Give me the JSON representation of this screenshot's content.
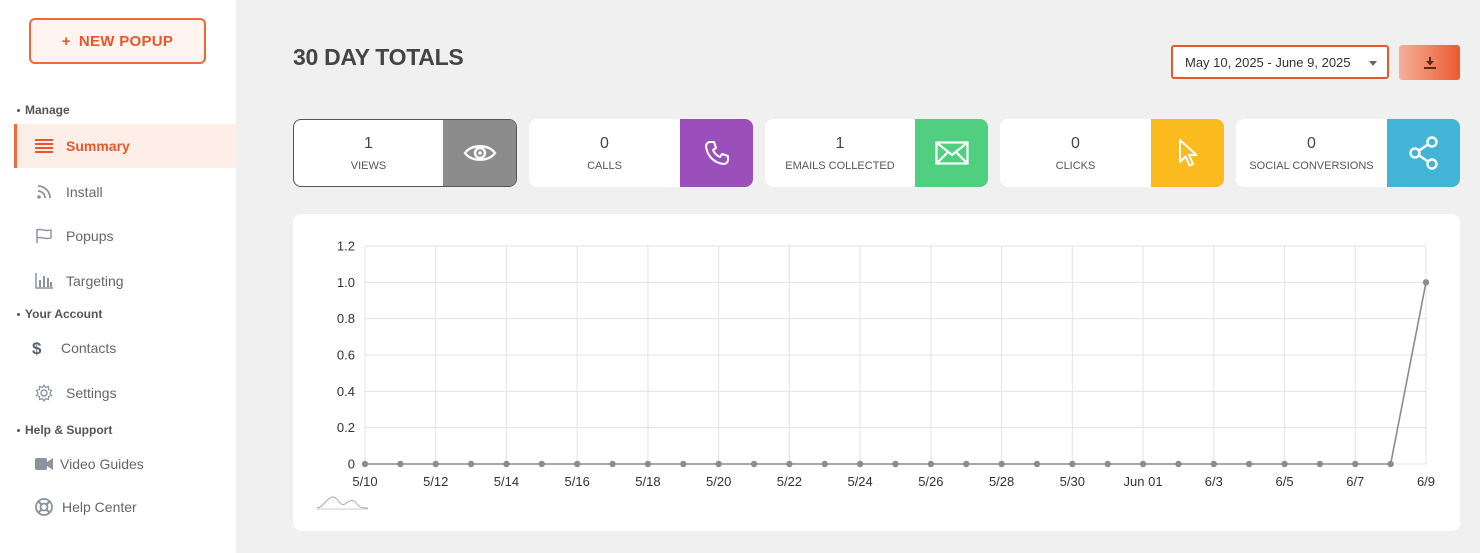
{
  "sidebar": {
    "new_popup_label": "NEW POPUP",
    "new_popup_icon": "+",
    "sections": {
      "manage": "Manage",
      "your_account": "Your Account",
      "help_support": "Help & Support"
    },
    "items": {
      "summary": "Summary",
      "install": "Install",
      "popups": "Popups",
      "targeting": "Targeting",
      "contacts": "Contacts",
      "settings": "Settings",
      "video_guides": "Video Guides",
      "help_center": "Help Center"
    }
  },
  "header": {
    "title": "30 DAY TOTALS",
    "date_range": "May 10, 2025 - June 9, 2025",
    "download_icon": "download-icon"
  },
  "stats": [
    {
      "value": "1",
      "label": "Views",
      "icon": "eye-icon",
      "color": "#8c8c8c"
    },
    {
      "value": "0",
      "label": "Calls",
      "icon": "phone-icon",
      "color": "#9b4fbb"
    },
    {
      "value": "1",
      "label": "Emails Collected",
      "icon": "envelope-icon",
      "color": "#4fcf7f"
    },
    {
      "value": "0",
      "label": "Clicks",
      "icon": "cursor-icon",
      "color": "#fbbb1e"
    },
    {
      "value": "0",
      "label": "Social Conversions",
      "icon": "share-icon",
      "color": "#42b4d6"
    }
  ],
  "colors": {
    "accent": "#e8572a",
    "line": "#8c8c8c"
  },
  "chart_data": {
    "type": "line",
    "title": "",
    "xlabel": "",
    "ylabel": "",
    "ylim": [
      0,
      1.2
    ],
    "yticks": [
      "0",
      "0.2",
      "0.4",
      "0.6",
      "0.8",
      "1.0",
      "1.2"
    ],
    "xtick_labels": [
      "5/10",
      "5/12",
      "5/14",
      "5/16",
      "5/18",
      "5/20",
      "5/22",
      "5/24",
      "5/26",
      "5/28",
      "5/30",
      "Jun 01",
      "6/3",
      "6/5",
      "6/7",
      "6/9"
    ],
    "grid": true,
    "series": [
      {
        "x": [
          "5/10",
          "5/11",
          "5/12",
          "5/13",
          "5/14",
          "5/15",
          "5/16",
          "5/17",
          "5/18",
          "5/19",
          "5/20",
          "5/21",
          "5/22",
          "5/23",
          "5/24",
          "5/25",
          "5/26",
          "5/27",
          "5/28",
          "5/29",
          "5/30",
          "5/31",
          "6/1",
          "6/2",
          "6/3",
          "6/4",
          "6/5",
          "6/6",
          "6/7",
          "6/8",
          "6/9"
        ],
        "values": [
          0,
          0,
          0,
          0,
          0,
          0,
          0,
          0,
          0,
          0,
          0,
          0,
          0,
          0,
          0,
          0,
          0,
          0,
          0,
          0,
          0,
          0,
          0,
          0,
          0,
          0,
          0,
          0,
          0,
          0,
          1
        ]
      }
    ]
  }
}
